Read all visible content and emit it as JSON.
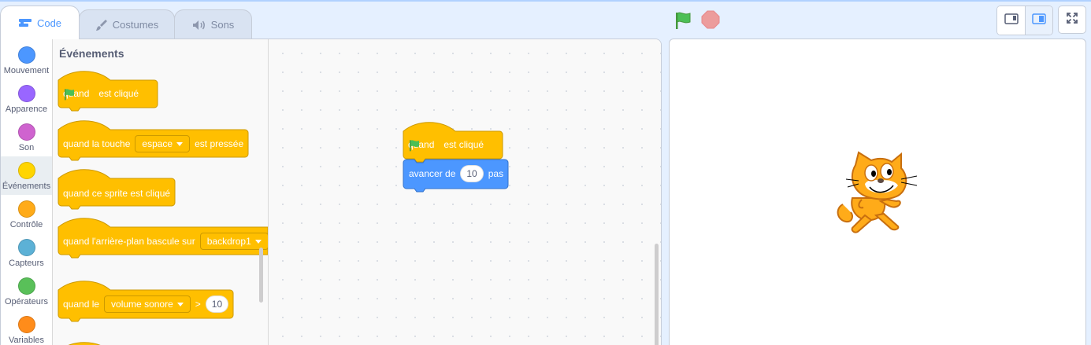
{
  "tabs": [
    {
      "label": "Code",
      "icon": "code-icon",
      "active": true
    },
    {
      "label": "Costumes",
      "icon": "brush-icon",
      "active": false
    },
    {
      "label": "Sons",
      "icon": "speaker-icon",
      "active": false
    }
  ],
  "controls": {
    "go": "green-flag-icon",
    "stop": "stop-icon"
  },
  "categories": [
    {
      "label": "Mouvement",
      "color": "#4c97ff"
    },
    {
      "label": "Apparence",
      "color": "#9966ff"
    },
    {
      "label": "Son",
      "color": "#cf63cf"
    },
    {
      "label": "Événements",
      "color": "#ffd500",
      "selected": true
    },
    {
      "label": "Contrôle",
      "color": "#ffab19"
    },
    {
      "label": "Capteurs",
      "color": "#5cb1d6"
    },
    {
      "label": "Opérateurs",
      "color": "#59c059"
    },
    {
      "label": "Variables",
      "color": "#ff8c1a"
    }
  ],
  "flyout": {
    "title": "Événements",
    "blocks": {
      "flag_clicked": {
        "pre": "quand",
        "post": "est cliqué"
      },
      "key_pressed": {
        "pre": "quand la touche",
        "dropdown": "espace",
        "post": "est pressée"
      },
      "sprite_clicked": {
        "text": "quand ce sprite est cliqué"
      },
      "backdrop_switch": {
        "pre": "quand l'arrière-plan bascule sur",
        "dropdown": "backdrop1"
      },
      "greater_than": {
        "pre": "quand le",
        "dropdown": "volume sonore",
        "op": ">",
        "value": "10"
      }
    }
  },
  "script": {
    "hat": {
      "pre": "quand",
      "post": "est cliqué"
    },
    "move": {
      "pre": "avancer de",
      "value": "10",
      "post": "pas"
    }
  },
  "colors": {
    "events": "#ffbf00",
    "events_border": "#cc9900",
    "motion": "#4c97ff",
    "motion_border": "#3373cc",
    "accent": "#4c97ff"
  }
}
